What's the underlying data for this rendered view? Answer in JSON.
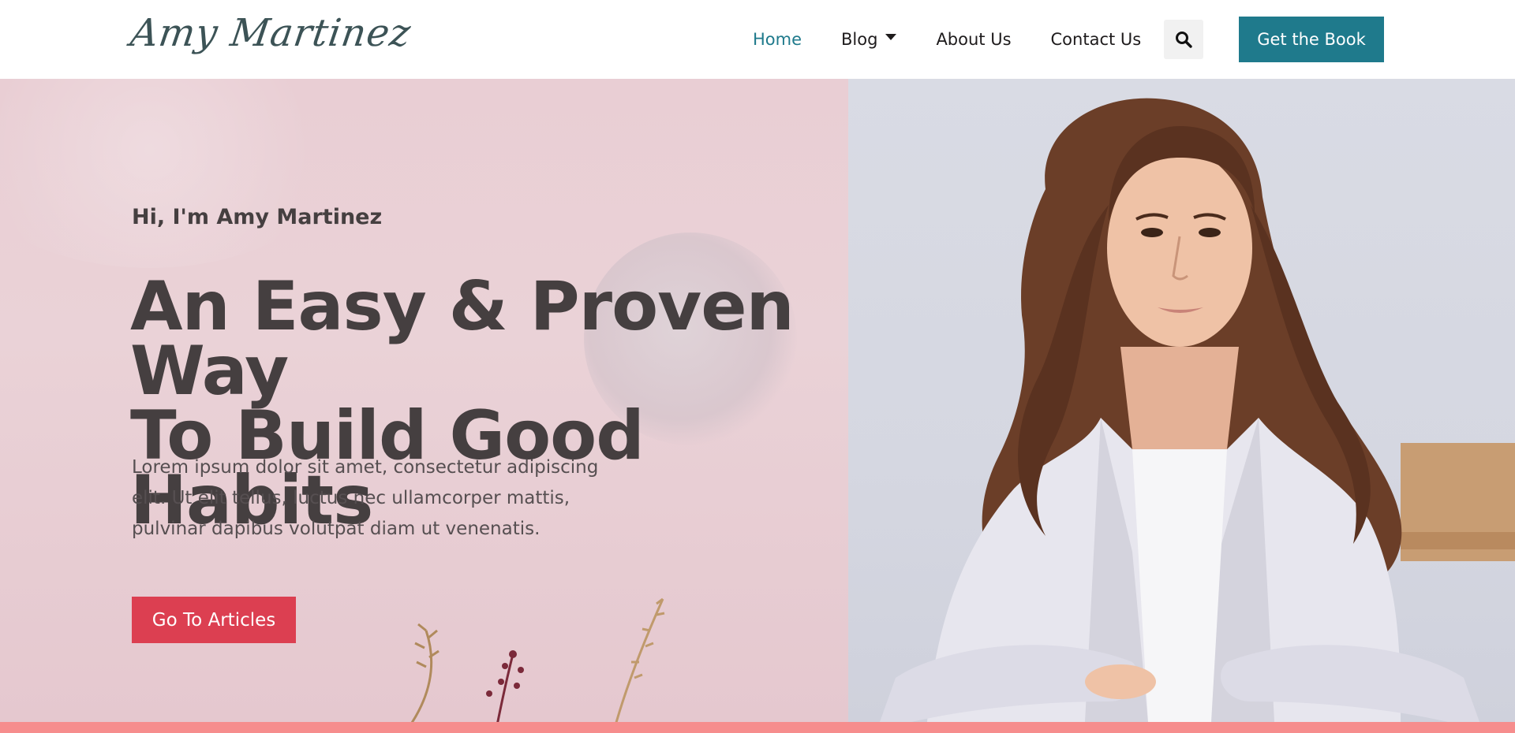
{
  "brand": {
    "logo_text": "Amy Martinez"
  },
  "nav": {
    "items": [
      {
        "label": "Home",
        "active": true
      },
      {
        "label": "Blog",
        "has_dropdown": true
      },
      {
        "label": "About Us"
      },
      {
        "label": "Contact Us"
      }
    ],
    "search_icon": "search-icon",
    "cta_label": "Get the Book"
  },
  "hero": {
    "greeting": "Hi, I'm Amy Martinez",
    "headline_line1": "An Easy & Proven Way",
    "headline_line2": "To Build Good Habits",
    "body": "Lorem ipsum dolor sit amet, consectetur adipiscing elit. Ut elit tellus, luctus nec ullamcorper mattis, pulvinar dapibus volutpat diam ut venenatis.",
    "cta_label": "Go To Articles"
  },
  "colors": {
    "accent_teal": "#1f7a8c",
    "accent_red": "#dc3f51",
    "bottom_bar": "#f68d8d",
    "hero_pink": "#e9ced4",
    "text_dark": "#453f40"
  }
}
